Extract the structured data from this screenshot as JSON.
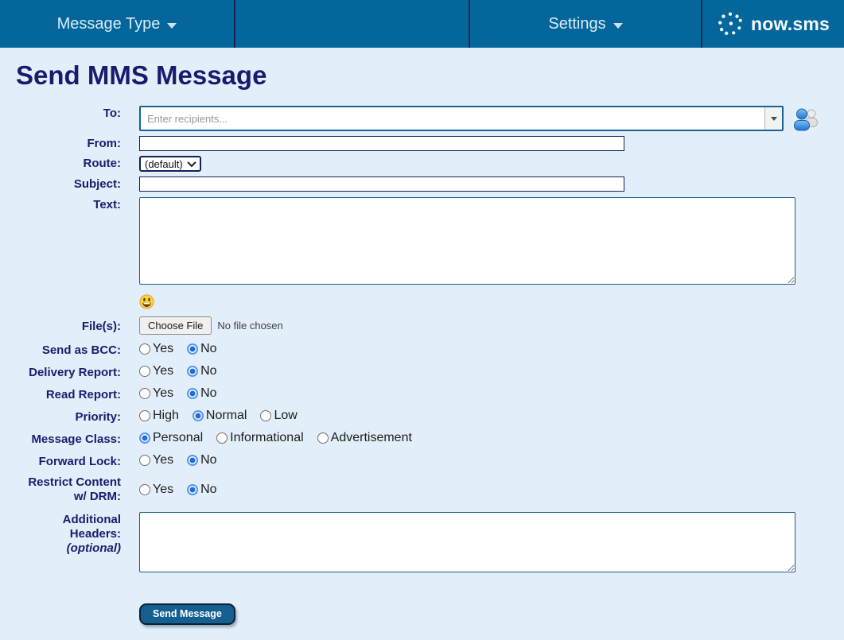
{
  "navbar": {
    "message_type_label": "Message Type",
    "settings_label": "Settings",
    "brand": "now.sms"
  },
  "page": {
    "title": "Send MMS Message"
  },
  "colors": {
    "navbar_bg": "#04669a",
    "navbar_divider": "#13264f",
    "page_bg": "#e2effa",
    "heading_text": "#1b1b6d",
    "field_border_blue": "#1b6191",
    "field_border_navy": "#10215b",
    "radio_selected": "#1d6fe0",
    "send_button_bg": "#135f90"
  },
  "form": {
    "to": {
      "label": "To:",
      "placeholder": "Enter recipients...",
      "value": "",
      "dropdown_icon": "caret-down-icon",
      "contacts_icon": "contacts-icon"
    },
    "from": {
      "label": "From:",
      "value": ""
    },
    "route": {
      "label": "Route:",
      "selected_option": "(default)"
    },
    "subject": {
      "label": "Subject:",
      "value": ""
    },
    "text": {
      "label": "Text:",
      "value": "",
      "emoji_icon": "grinning-face-icon"
    },
    "files": {
      "label": "File(s):",
      "button_label": "Choose File",
      "status_text": "No file chosen"
    },
    "radio_groups": [
      {
        "label": "Send as BCC:",
        "selected": "No",
        "options": [
          {
            "label": "Yes",
            "selected": false
          },
          {
            "label": "No",
            "selected": true
          }
        ]
      },
      {
        "label": "Delivery Report:",
        "selected": "No",
        "options": [
          {
            "label": "Yes",
            "selected": false
          },
          {
            "label": "No",
            "selected": true
          }
        ]
      },
      {
        "label": "Read Report:",
        "selected": "No",
        "options": [
          {
            "label": "Yes",
            "selected": false
          },
          {
            "label": "No",
            "selected": true
          }
        ]
      },
      {
        "label": "Priority:",
        "selected": "Normal",
        "options": [
          {
            "label": "High",
            "selected": false
          },
          {
            "label": "Normal",
            "selected": true
          },
          {
            "label": "Low",
            "selected": false
          }
        ]
      },
      {
        "label": "Message Class:",
        "selected": "Personal",
        "options": [
          {
            "label": "Personal",
            "selected": true
          },
          {
            "label": "Informational",
            "selected": false
          },
          {
            "label": "Advertisement",
            "selected": false
          }
        ]
      },
      {
        "label": "Forward Lock:",
        "selected": "No",
        "options": [
          {
            "label": "Yes",
            "selected": false
          },
          {
            "label": "No",
            "selected": true
          }
        ]
      },
      {
        "label": "Restrict Content w/ DRM:",
        "selected": "No",
        "options": [
          {
            "label": "Yes",
            "selected": false
          },
          {
            "label": "No",
            "selected": true
          }
        ]
      }
    ],
    "additional_headers": {
      "label": "Additional Headers:",
      "note": "(optional)",
      "value": ""
    },
    "submit_label": "Send Message"
  }
}
